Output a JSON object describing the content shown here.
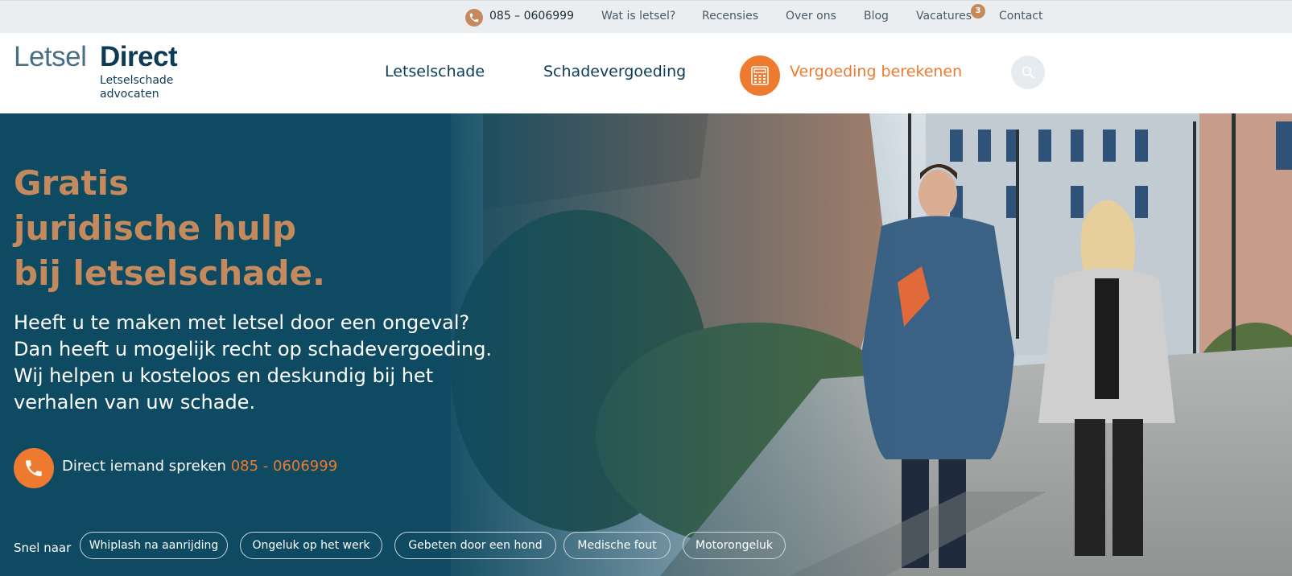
{
  "topbar": {
    "phone": "085 – 0606999",
    "links": [
      "Wat is letsel?",
      "Recensies",
      "Over ons",
      "Blog",
      "Vacatures",
      "Contact"
    ],
    "vacatures_badge": "3"
  },
  "logo": {
    "word1": "Letsel",
    "word2": "Direct",
    "sub1": "Letselschade",
    "sub2": "advocaten"
  },
  "nav": {
    "item1": "Letselschade",
    "item2": "Schadevergoeding",
    "cta": "Vergoeding berekenen"
  },
  "hero": {
    "title_lines": [
      "Gratis",
      "juridische hulp",
      "bij letselschade."
    ],
    "body_lines": [
      "Heeft u te maken met letsel door een ongeval?",
      "Dan heeft u mogelijk recht op schadevergoeding.",
      "Wij helpen u kosteloos en deskundig bij het",
      "verhalen van uw schade."
    ],
    "call_label": "Direct iemand spreken",
    "call_number": "085 - 0606999"
  },
  "quicklinks": {
    "label": "Snel naar",
    "items": [
      "Whiplash na aanrijding",
      "Ongeluk op het werk",
      "Gebeten door een hond",
      "Medische fout",
      "Motorongeluk"
    ]
  },
  "colors": {
    "brand_dark": "#0d3b56",
    "brand_teal": "#0e4a61",
    "accent_orange": "#ee7a30",
    "accent_copper": "#c48a5e"
  },
  "icons": [
    "phone-icon",
    "calculator-icon",
    "search-icon",
    "call-icon"
  ]
}
